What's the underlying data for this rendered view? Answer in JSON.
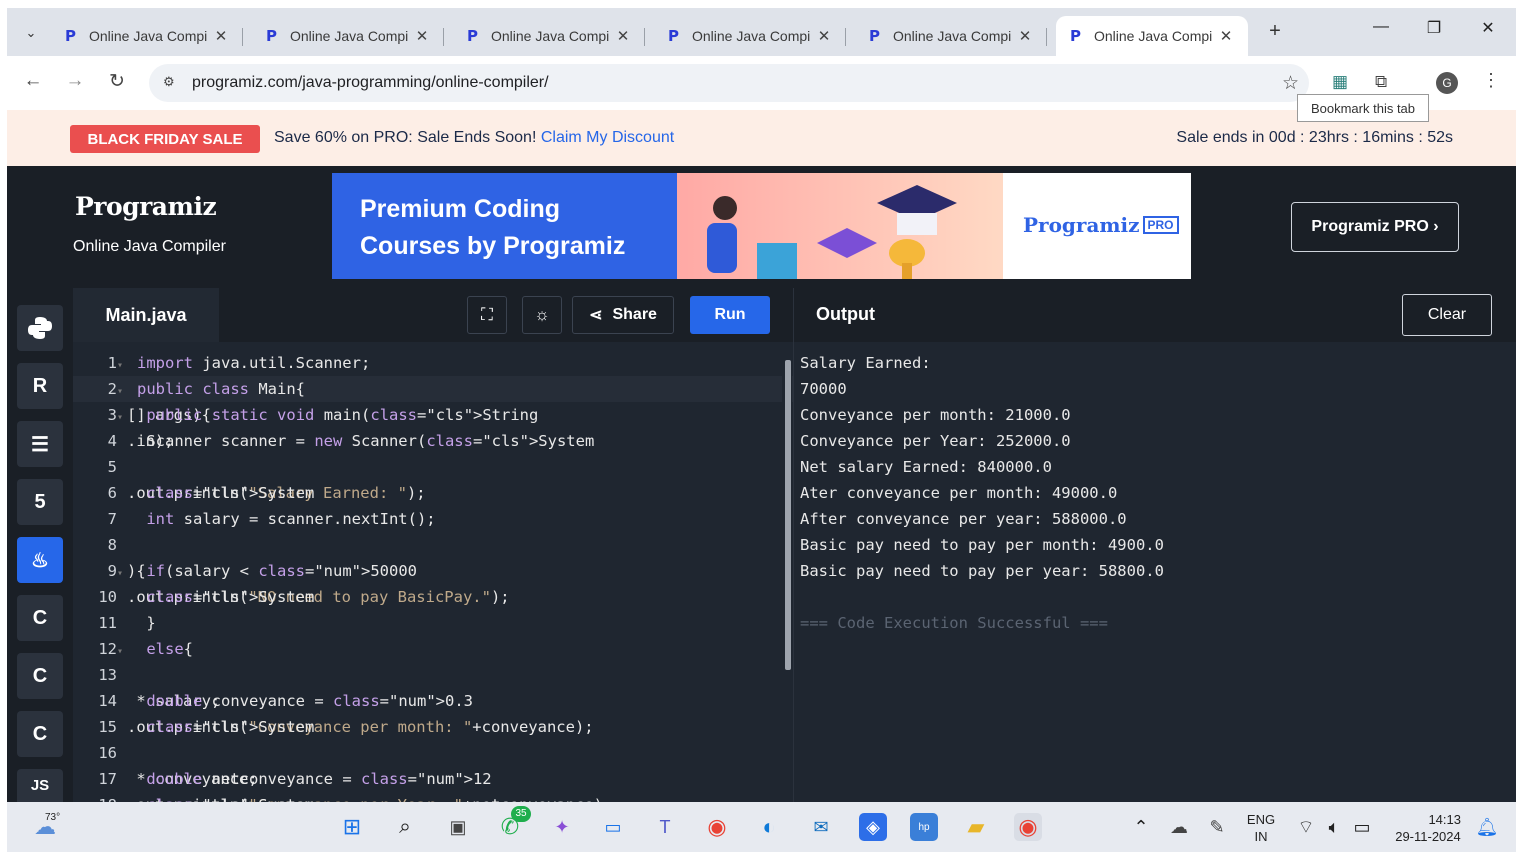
{
  "browser": {
    "tabs": [
      {
        "title": "Online Java Compi",
        "active": false
      },
      {
        "title": "Online Java Compi",
        "active": false
      },
      {
        "title": "Online Java Compi",
        "active": false
      },
      {
        "title": "Online Java Compi",
        "active": false
      },
      {
        "title": "Online Java Compi",
        "active": false
      },
      {
        "title": "Online Java Compi",
        "active": true
      }
    ],
    "url": "programiz.com/java-programming/online-compiler/",
    "tooltip": "Bookmark this tab",
    "avatar_letter": "G"
  },
  "promo": {
    "badge": "BLACK FRIDAY SALE",
    "text": "Save 60% on PRO: Sale Ends Soon! ",
    "link": "Claim My Discount",
    "countdown": "Sale ends in 00d : 23hrs : 16mins : 52s"
  },
  "header": {
    "logo": "Programiz",
    "subtitle": "Online Java Compiler",
    "ad_line1": "Premium Coding",
    "ad_line2": "Courses by Programiz",
    "ad_logo": "Programiz",
    "ad_pro": "PRO",
    "pro_button": "Programiz PRO ›"
  },
  "sidebar": {
    "languages": [
      "python",
      "r",
      "sql",
      "html",
      "java",
      "c",
      "cpp",
      "csharp",
      "JS"
    ],
    "js_label": "JS"
  },
  "editor": {
    "filename": "Main.java",
    "share_label": "Share",
    "run_label": "Run",
    "lines": [
      {
        "n": "1",
        "fold": true,
        "code": "import java.util.Scanner;"
      },
      {
        "n": "2",
        "fold": true,
        "code": "public class Main{"
      },
      {
        "n": "3",
        "fold": true,
        "code": " public static void main(String[] args){"
      },
      {
        "n": "4",
        "fold": false,
        "code": " Scanner scanner = new Scanner(System.in);"
      },
      {
        "n": "5",
        "fold": false,
        "code": ""
      },
      {
        "n": "6",
        "fold": false,
        "code": " System.out.println(\"Salary Earned: \");"
      },
      {
        "n": "7",
        "fold": false,
        "code": " int salary = scanner.nextInt();"
      },
      {
        "n": "8",
        "fold": false,
        "code": ""
      },
      {
        "n": "9",
        "fold": true,
        "code": " if(salary < 50000){"
      },
      {
        "n": "10",
        "fold": false,
        "code": " System.out.println(\"NO need to pay BasicPay.\");"
      },
      {
        "n": "11",
        "fold": false,
        "code": " }"
      },
      {
        "n": "12",
        "fold": true,
        "code": " else{"
      },
      {
        "n": "13",
        "fold": false,
        "code": ""
      },
      {
        "n": "14",
        "fold": false,
        "code": " double conveyance = 0.3 * salary;"
      },
      {
        "n": "15",
        "fold": false,
        "code": " System.out.println(\"Conveyance per month: \"+conveyance);"
      },
      {
        "n": "16",
        "fold": false,
        "code": ""
      },
      {
        "n": "17",
        "fold": false,
        "code": " double netconveyance = 12 * conveyance;"
      },
      {
        "n": "18",
        "fold": false,
        "code": " System.out.println(\"Conveyance per Year: \"+netconveyance);"
      }
    ]
  },
  "output": {
    "title": "Output",
    "clear_label": "Clear",
    "lines": [
      "Salary Earned:",
      "70000",
      "Conveyance per month: 21000.0",
      "Conveyance per Year: 252000.0",
      "Net salary Earned: 840000.0",
      "Ater conveyance per month: 49000.0",
      "After conveyance per year: 588000.0",
      "Basic pay need to pay per month: 4900.0",
      "Basic pay need to pay per year: 58800.0",
      "",
      "=== Code Execution Successful ==="
    ]
  },
  "taskbar": {
    "weather": "73°",
    "chat_badge": "35",
    "lang_line1": "ENG",
    "lang_line2": "IN",
    "time": "14:13",
    "date": "29-11-2024"
  },
  "colors": {
    "accent": "#2667e9",
    "sale_red": "#ea4f4f",
    "editor_bg": "#1f2630",
    "header_bg": "#1a1f26"
  }
}
